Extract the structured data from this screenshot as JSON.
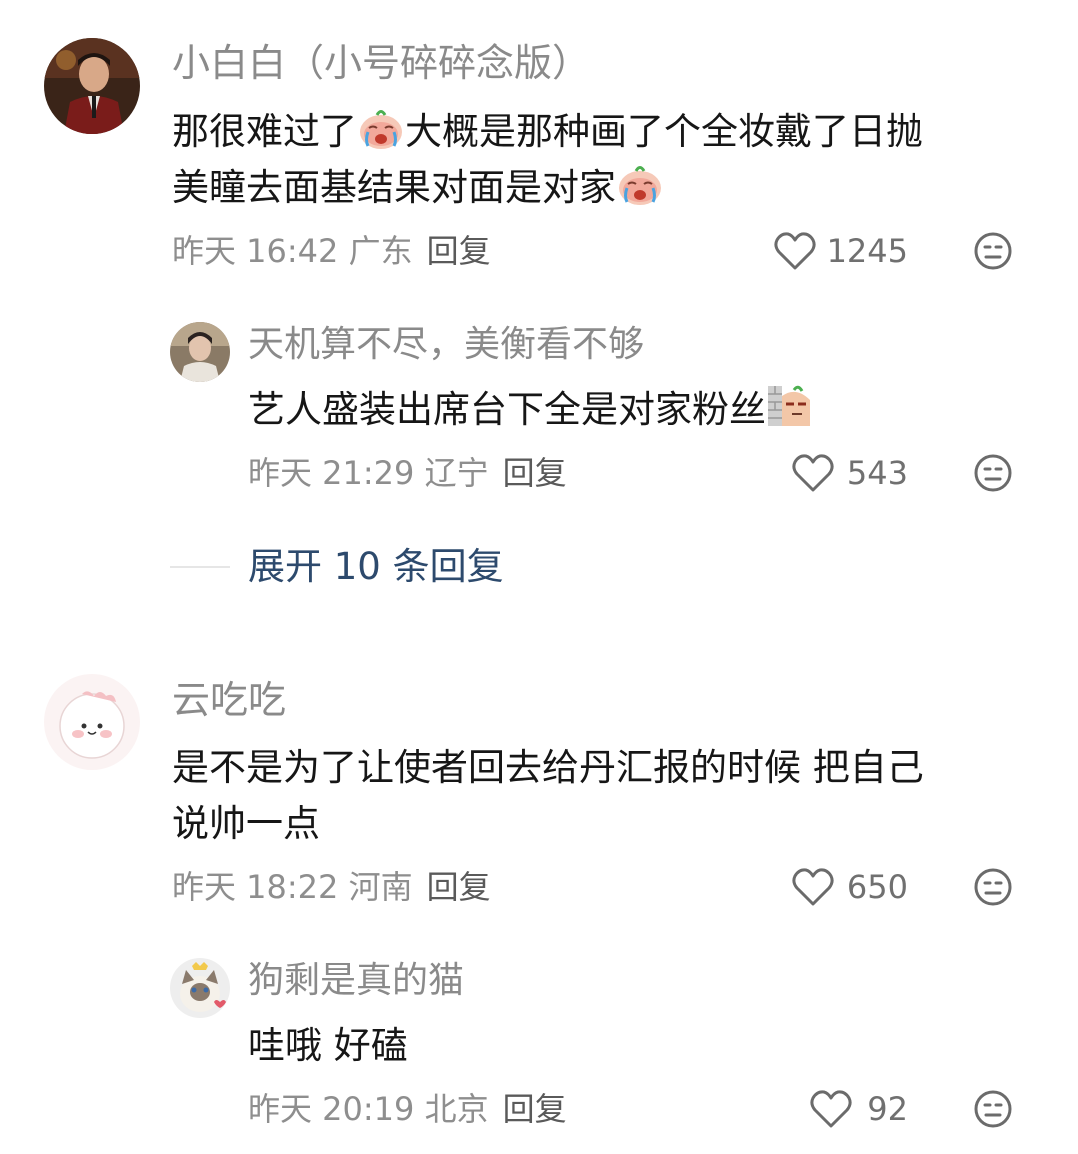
{
  "comments": [
    {
      "name": "小白白（小号碎碎念版）",
      "text_line1": "那很难过了",
      "text_line1_rest": "大概是那种画了个全妆戴了日抛",
      "text_line2": "美瞳去面基结果对面是对家",
      "meta": "昨天 16:42 广东",
      "reply": "回复",
      "likes": "1245",
      "replies": [
        {
          "name": "天机算不尽，美衡看不够",
          "text": "艺人盛装出席台下全是对家粉丝",
          "meta": "昨天 21:29 辽宁",
          "reply": "回复",
          "likes": "543"
        }
      ],
      "expand_label": "展开 10 条回复"
    },
    {
      "name": "云吃吃",
      "text_line1": "是不是为了让使者回去给丹汇报的时候 把自己",
      "text_line2": "说帅一点",
      "meta": "昨天 18:22 河南",
      "reply": "回复",
      "likes": "650",
      "replies": [
        {
          "name": "狗剩是真的猫",
          "text": "哇哦 好磕",
          "meta": "昨天 20:19 北京",
          "reply": "回复",
          "likes": "92"
        }
      ]
    }
  ],
  "icons": {
    "like": "heart-outline-icon",
    "dislike": "meh-face-icon",
    "emoji_cry": "crying-emoji",
    "emoji_wall": "peeking-emoji"
  },
  "colors": {
    "username": "#8a8a8a",
    "body_text": "#161616",
    "meta": "#8e8e8e",
    "expand": "#2d4a6d"
  }
}
